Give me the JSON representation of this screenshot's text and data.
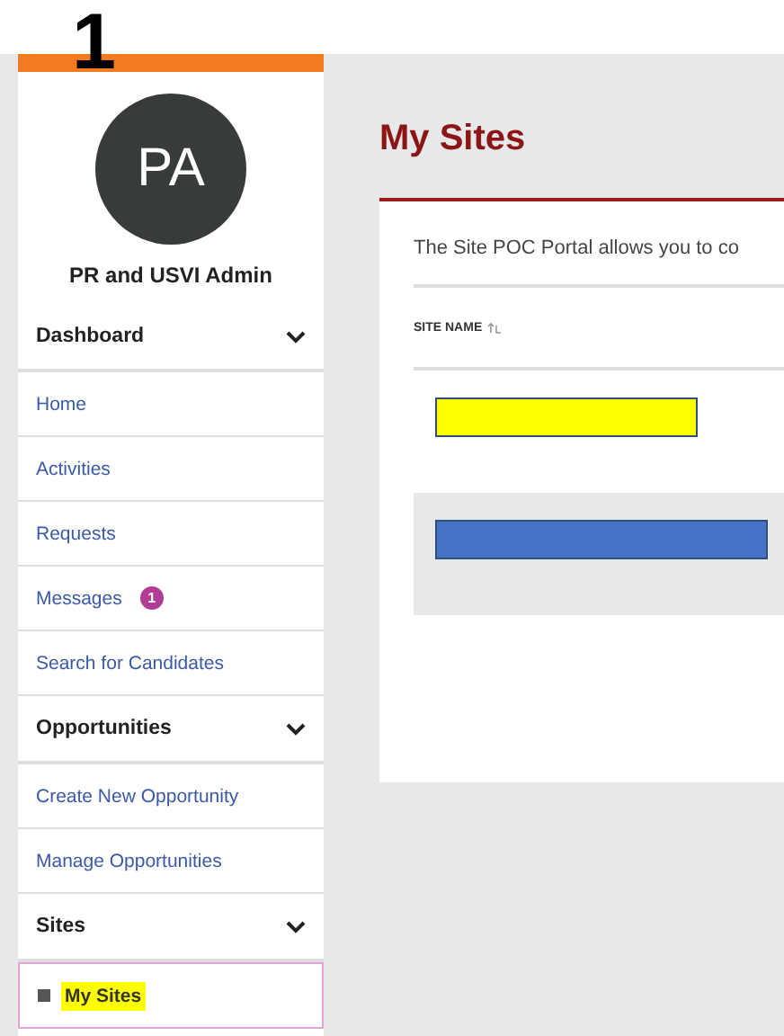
{
  "annotation": "1",
  "sidebar": {
    "avatar_initials": "PA",
    "user_name": "PR and USVI Admin",
    "sections": [
      {
        "title": "Dashboard",
        "expanded": true,
        "items": [
          {
            "label": "Home",
            "selected": false
          },
          {
            "label": "Activities",
            "selected": false
          },
          {
            "label": "Requests",
            "selected": false
          },
          {
            "label": "Messages",
            "selected": false,
            "badge": "1"
          },
          {
            "label": "Search for Candidates",
            "selected": false
          }
        ]
      },
      {
        "title": "Opportunities",
        "expanded": true,
        "items": [
          {
            "label": "Create New Opportunity",
            "selected": false
          },
          {
            "label": "Manage Opportunities",
            "selected": false
          }
        ]
      },
      {
        "title": "Sites",
        "expanded": true,
        "items": [
          {
            "label": "My Sites",
            "selected": true
          }
        ]
      }
    ]
  },
  "main": {
    "title": "My Sites",
    "intro": "The Site POC Portal allows you to co",
    "table": {
      "columns": [
        {
          "label": "SITE NAME",
          "sorted": true
        }
      ],
      "rows": [
        {
          "shaded": false,
          "color": "#ffff00"
        },
        {
          "shaded": true,
          "color": "#4472c4"
        }
      ]
    }
  }
}
